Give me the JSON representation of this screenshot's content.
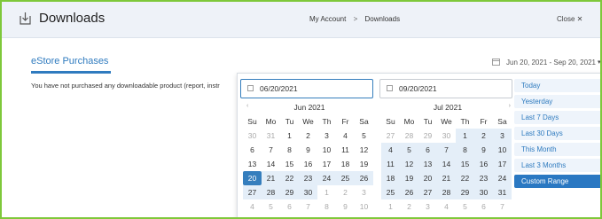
{
  "header": {
    "title": "Downloads",
    "breadcrumb": [
      "My Account",
      "Downloads"
    ],
    "breadcrumb_sep": ">",
    "close_label": "Close ✕"
  },
  "tab": {
    "label": "eStore Purchases"
  },
  "notice": "You have not purchased any downloadable product (report, instr",
  "range_button": {
    "value": "Jun 20, 2021 - Sep 20, 2021",
    "caret": "▾"
  },
  "picker": {
    "start_input": "06/20/2021",
    "end_input": "09/20/2021",
    "nav_prev": "‹",
    "nav_next": "›",
    "weekdays": [
      "Su",
      "Mo",
      "Tu",
      "We",
      "Th",
      "Fr",
      "Sa"
    ],
    "left_calendar": {
      "month": "Jun 2021",
      "days": [
        [
          "30",
          "off"
        ],
        [
          "31",
          "off"
        ],
        [
          "1",
          ""
        ],
        [
          "2",
          ""
        ],
        [
          "3",
          ""
        ],
        [
          "4",
          ""
        ],
        [
          "5",
          ""
        ],
        [
          "6",
          ""
        ],
        [
          "7",
          ""
        ],
        [
          "8",
          ""
        ],
        [
          "9",
          ""
        ],
        [
          "10",
          ""
        ],
        [
          "11",
          ""
        ],
        [
          "12",
          ""
        ],
        [
          "13",
          ""
        ],
        [
          "14",
          ""
        ],
        [
          "15",
          ""
        ],
        [
          "16",
          ""
        ],
        [
          "17",
          ""
        ],
        [
          "18",
          ""
        ],
        [
          "19",
          ""
        ],
        [
          "20",
          "sel"
        ],
        [
          "21",
          "in"
        ],
        [
          "22",
          "in"
        ],
        [
          "23",
          "in"
        ],
        [
          "24",
          "in"
        ],
        [
          "25",
          "in"
        ],
        [
          "26",
          "in"
        ],
        [
          "27",
          "in"
        ],
        [
          "28",
          "in"
        ],
        [
          "29",
          "in"
        ],
        [
          "30",
          "in"
        ],
        [
          "1",
          "off"
        ],
        [
          "2",
          "off"
        ],
        [
          "3",
          "off"
        ],
        [
          "4",
          "off"
        ],
        [
          "5",
          "off"
        ],
        [
          "6",
          "off"
        ],
        [
          "7",
          "off"
        ],
        [
          "8",
          "off"
        ],
        [
          "9",
          "off"
        ],
        [
          "10",
          "off"
        ]
      ]
    },
    "right_calendar": {
      "month": "Jul 2021",
      "days": [
        [
          "27",
          "off"
        ],
        [
          "28",
          "off"
        ],
        [
          "29",
          "off"
        ],
        [
          "30",
          "off"
        ],
        [
          "1",
          "in"
        ],
        [
          "2",
          "in"
        ],
        [
          "3",
          "in"
        ],
        [
          "4",
          "in"
        ],
        [
          "5",
          "in"
        ],
        [
          "6",
          "in"
        ],
        [
          "7",
          "in"
        ],
        [
          "8",
          "in"
        ],
        [
          "9",
          "in"
        ],
        [
          "10",
          "in"
        ],
        [
          "11",
          "in"
        ],
        [
          "12",
          "in"
        ],
        [
          "13",
          "in"
        ],
        [
          "14",
          "in"
        ],
        [
          "15",
          "in"
        ],
        [
          "16",
          "in"
        ],
        [
          "17",
          "in"
        ],
        [
          "18",
          "in"
        ],
        [
          "19",
          "in"
        ],
        [
          "20",
          "in"
        ],
        [
          "21",
          "in"
        ],
        [
          "22",
          "in"
        ],
        [
          "23",
          "in"
        ],
        [
          "24",
          "in"
        ],
        [
          "25",
          "in"
        ],
        [
          "26",
          "in"
        ],
        [
          "27",
          "in"
        ],
        [
          "28",
          "in"
        ],
        [
          "29",
          "in"
        ],
        [
          "30",
          "in"
        ],
        [
          "31",
          "in"
        ],
        [
          "1",
          "off"
        ],
        [
          "2",
          "off"
        ],
        [
          "3",
          "off"
        ],
        [
          "4",
          "off"
        ],
        [
          "5",
          "off"
        ],
        [
          "6",
          "off"
        ],
        [
          "7",
          "off"
        ]
      ]
    },
    "ranges": [
      {
        "label": "Today",
        "active": false
      },
      {
        "label": "Yesterday",
        "active": false
      },
      {
        "label": "Last 7 Days",
        "active": false
      },
      {
        "label": "Last 30 Days",
        "active": false
      },
      {
        "label": "This Month",
        "active": false
      },
      {
        "label": "Last 3 Months",
        "active": false
      },
      {
        "label": "Custom Range",
        "active": true
      }
    ]
  },
  "colors": {
    "accent": "#2f7bbf",
    "selected": "#357ebd",
    "in_range": "#e4eef8",
    "frame": "#7ec83a",
    "header_bg": "#eef2f8"
  },
  "icons": {
    "header": "downloads-icon",
    "calendar": "calendar-icon",
    "caret": "caret-down-icon",
    "close": "close-icon"
  }
}
